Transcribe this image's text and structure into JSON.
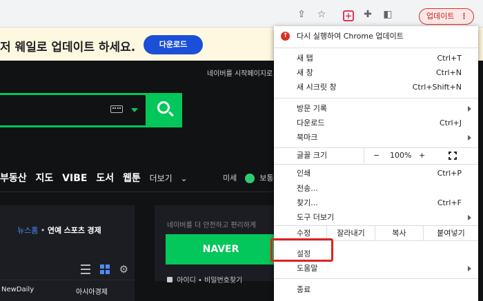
{
  "toolbar": {
    "update_label": "업데이트",
    "more_glyph": "⋮",
    "icons": [
      "share-icon",
      "star-icon",
      "extension-red-icon",
      "puzzle-icon",
      "sidepanel-icon"
    ]
  },
  "banner": {
    "text": "저 웨일로 업데이트 하세요.",
    "download_label": "다운로드"
  },
  "page": {
    "start_page": "네이버를 시작페이지로",
    "nav_items": [
      "부동산",
      "지도",
      "VIBE",
      "도서",
      "웹툰"
    ],
    "more_label": "더보기",
    "dust_label": "미세",
    "dust_value": "보통",
    "news_tabs": {
      "active": "뉴스홈",
      "tabs": [
        "연예",
        "스포츠",
        "경제"
      ]
    },
    "login_desc": "네이버를 더 안전하고 편리하게",
    "naver_button": "NAVER",
    "find_id": "아이디 • 비밀번호찾기",
    "bottom_cells": [
      "NewDaily",
      "아시아경제"
    ]
  },
  "menu": {
    "update": "다시 실행하여 Chrome 업데이트",
    "new_tab": "새 탭",
    "new_tab_sc": "Ctrl+T",
    "new_window": "새 창",
    "new_window_sc": "Ctrl+N",
    "incognito": "새 시크릿 창",
    "incognito_sc": "Ctrl+Shift+N",
    "history": "방문 기록",
    "downloads": "다운로드",
    "downloads_sc": "Ctrl+J",
    "bookmarks": "북마크",
    "zoom_label": "글꼴 크기",
    "zoom_minus": "−",
    "zoom_value": "100%",
    "zoom_plus": "+",
    "print": "인쇄",
    "print_sc": "Ctrl+P",
    "cast": "전송...",
    "find": "찾기...",
    "find_sc": "Ctrl+F",
    "more_tools": "도구 더보기",
    "edit": "수정",
    "cut": "잘라내기",
    "copy": "복사",
    "paste": "붙여넣기",
    "settings": "설정",
    "help": "도움말",
    "exit": "종료"
  },
  "colors": {
    "accent_green": "#03c75a",
    "highlight_red": "#e0201f",
    "update_red": "#d93025"
  }
}
